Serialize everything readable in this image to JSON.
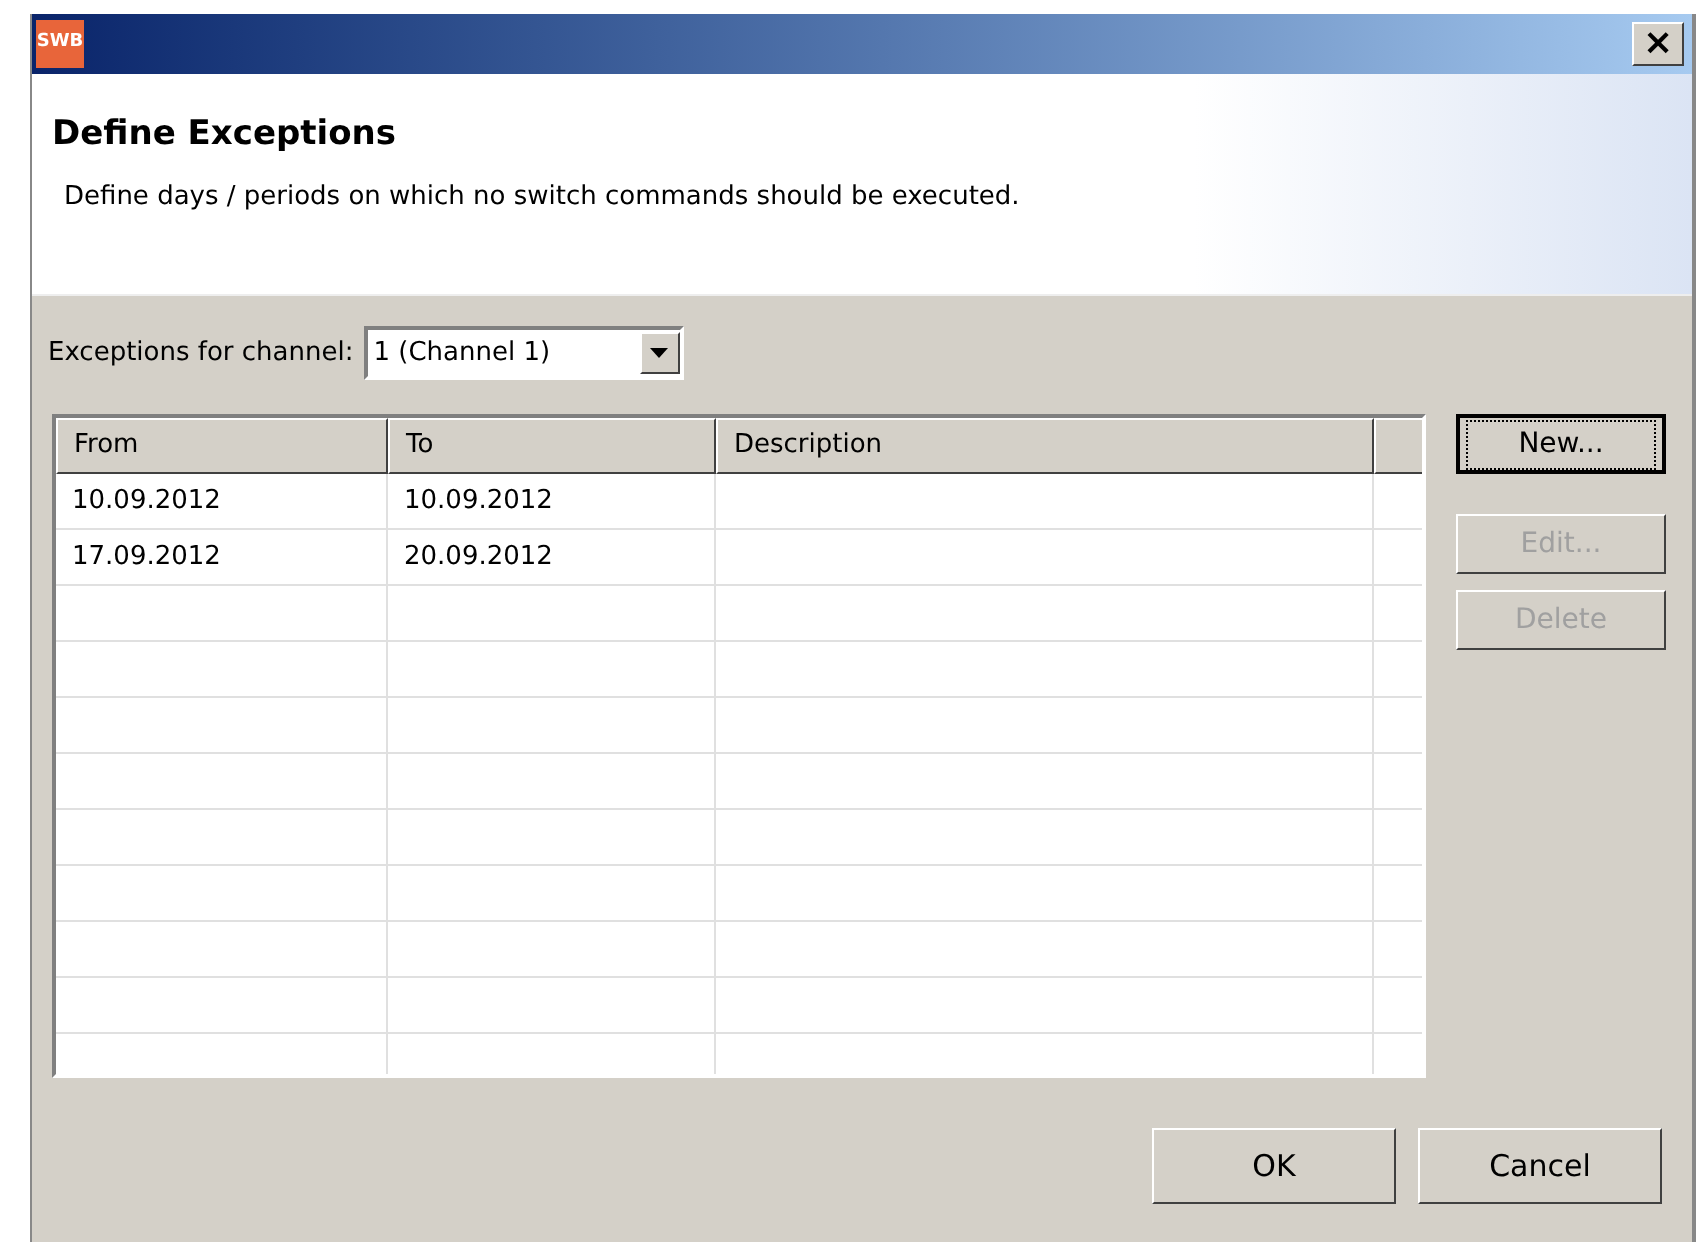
{
  "window": {
    "app_icon_text": "SWB",
    "close": "×"
  },
  "header": {
    "title": "Define Exceptions",
    "description": "Define days / periods on which no switch commands should be executed."
  },
  "channel": {
    "label": "Exceptions for channel:",
    "value": "1 (Channel 1)"
  },
  "table": {
    "columns": [
      "From",
      "To",
      "Description"
    ],
    "rows": [
      {
        "from": "10.09.2012",
        "to": "10.09.2012"
      },
      {
        "from": "17.09.2012",
        "to": "20.09.2012"
      }
    ]
  },
  "side_buttons": [
    {
      "label": "New...",
      "disabled": false,
      "focused": true
    },
    {
      "label": "Edit...",
      "disabled": true,
      "focused": false
    },
    {
      "label": "Delete",
      "disabled": true,
      "focused": false
    }
  ],
  "buttons": [
    "OK",
    "Cancel"
  ]
}
